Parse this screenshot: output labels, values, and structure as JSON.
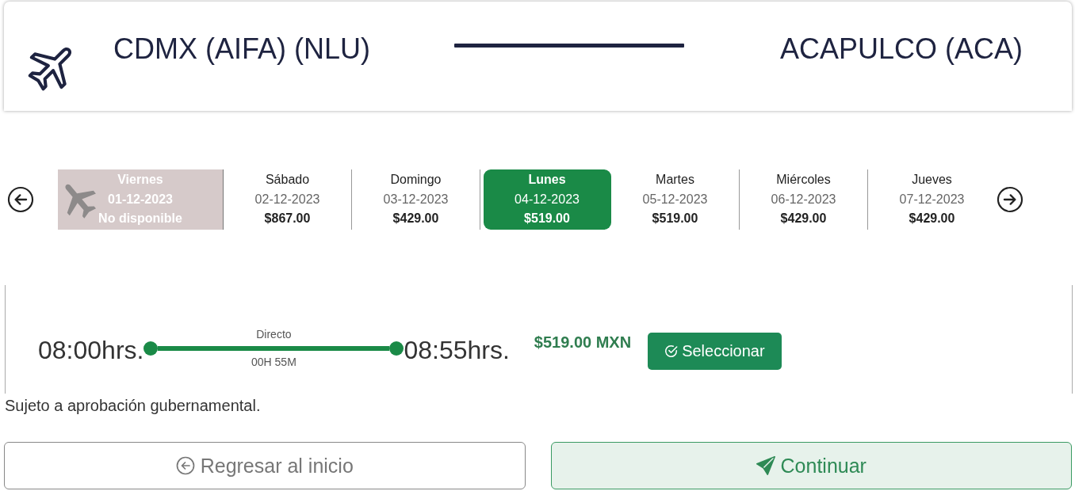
{
  "route": {
    "origin": "CDMX (AIFA) (NLU)",
    "destination": "ACAPULCO (ACA)"
  },
  "dates": [
    {
      "day": "Viernes",
      "date": "01-12-2023",
      "price": "No disponible",
      "available": false,
      "selected": false
    },
    {
      "day": "Sábado",
      "date": "02-12-2023",
      "price": "$867.00",
      "available": true,
      "selected": false
    },
    {
      "day": "Domingo",
      "date": "03-12-2023",
      "price": "$429.00",
      "available": true,
      "selected": false
    },
    {
      "day": "Lunes",
      "date": "04-12-2023",
      "price": "$519.00",
      "available": true,
      "selected": true
    },
    {
      "day": "Martes",
      "date": "05-12-2023",
      "price": "$519.00",
      "available": true,
      "selected": false
    },
    {
      "day": "Miércoles",
      "date": "06-12-2023",
      "price": "$429.00",
      "available": true,
      "selected": false
    },
    {
      "day": "Jueves",
      "date": "07-12-2023",
      "price": "$429.00",
      "available": true,
      "selected": false
    }
  ],
  "flight": {
    "departure": "08:00hrs.",
    "stops": "Directo",
    "duration": "00H 55M",
    "arrival": "08:55hrs.",
    "price": "$519.00 MXN",
    "select_button": "Seleccionar"
  },
  "note": "Sujeto a aprobación gubernamental.",
  "buttons": [
    {
      "kind": "back",
      "label": "Regresar al inicio"
    },
    {
      "kind": "primary",
      "label": "Continuar"
    }
  ]
}
